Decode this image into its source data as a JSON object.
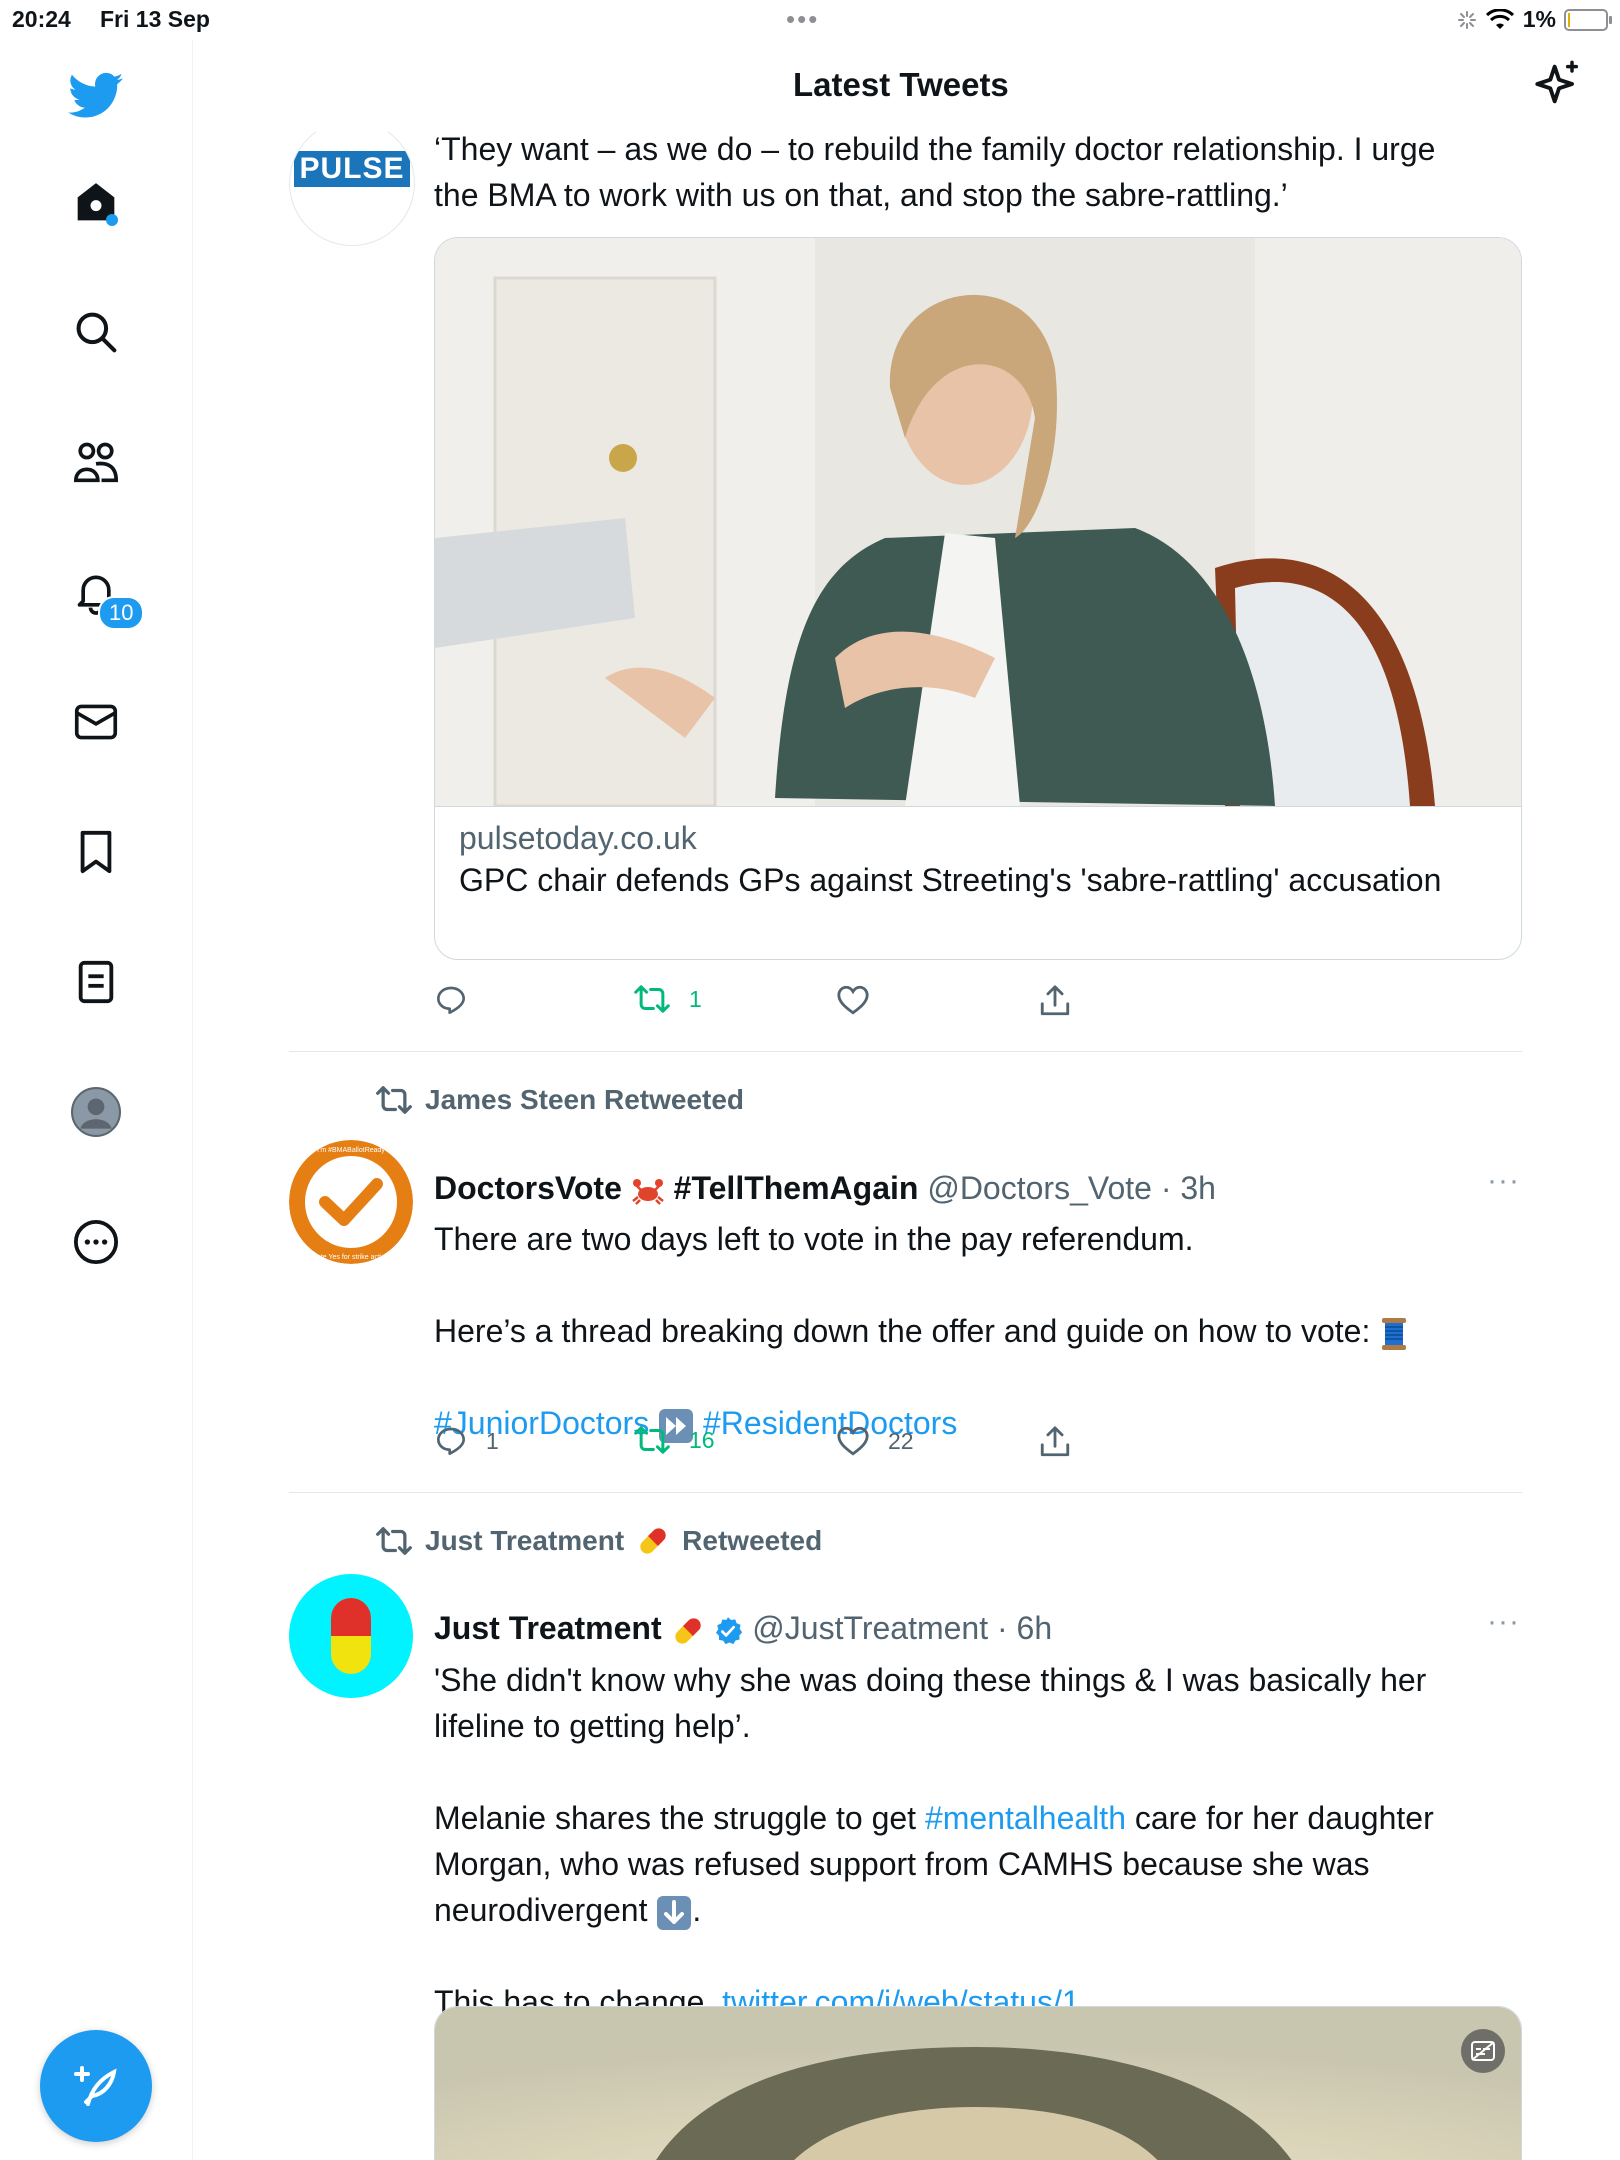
{
  "status_bar": {
    "time": "20:24",
    "date": "Fri 13 Sep",
    "battery": "1%"
  },
  "header": {
    "title": "Latest Tweets"
  },
  "sidebar": {
    "notification_count": "10"
  },
  "tweet1": {
    "avatar_text": "PULSE",
    "text_line1": "‘They want – as we do – to rebuild the family doctor relationship. I urge",
    "text_line2": "the BMA to work with us on that, and stop the sabre-rattling.’",
    "card": {
      "domain": "pulsetoday.co.uk",
      "title": "GPC chair defends GPs against Streeting's 'sabre-rattling' accusation"
    },
    "retweets": "1"
  },
  "tweet2": {
    "retweeted_by": "James Steen Retweeted",
    "name": "DoctorsVote",
    "name_tag": "#TellThemAgain",
    "handle": "@Doctors_Vote",
    "time": "3h",
    "line1": "There are two days left to vote in the pay referendum.",
    "line2": "Here’s a thread breaking down the offer and guide on how to vote:",
    "hashtag1": "#JuniorDoctors",
    "hashtag2": "#ResidentDoctors",
    "replies": "1",
    "retweets": "16",
    "likes": "22",
    "avatar_text_top": "I'm #BMABallotReady",
    "avatar_text_bottom": "Vote Yes for strike action"
  },
  "tweet3": {
    "retweeted_by_name": "Just Treatment",
    "retweeted_by_suffix": "Retweeted",
    "name": "Just Treatment",
    "handle": "@JustTreatment",
    "time": "6h",
    "para1_line1": "'She didn't know why she was doing these things & I was basically her",
    "para1_line2": "lifeline to getting help’.",
    "para2_pre": "Melanie shares the struggle to get ",
    "para2_hashtag": "#mentalhealth",
    "para2_post": " care for her daughter",
    "para2_line2": "Morgan, who was refused support from CAMHS because she was",
    "para2_line3": "neurodivergent",
    "para2_end": ".",
    "para3_pre": "This has to change. ",
    "para3_link": "twitter.com/i/web/status/1…"
  }
}
